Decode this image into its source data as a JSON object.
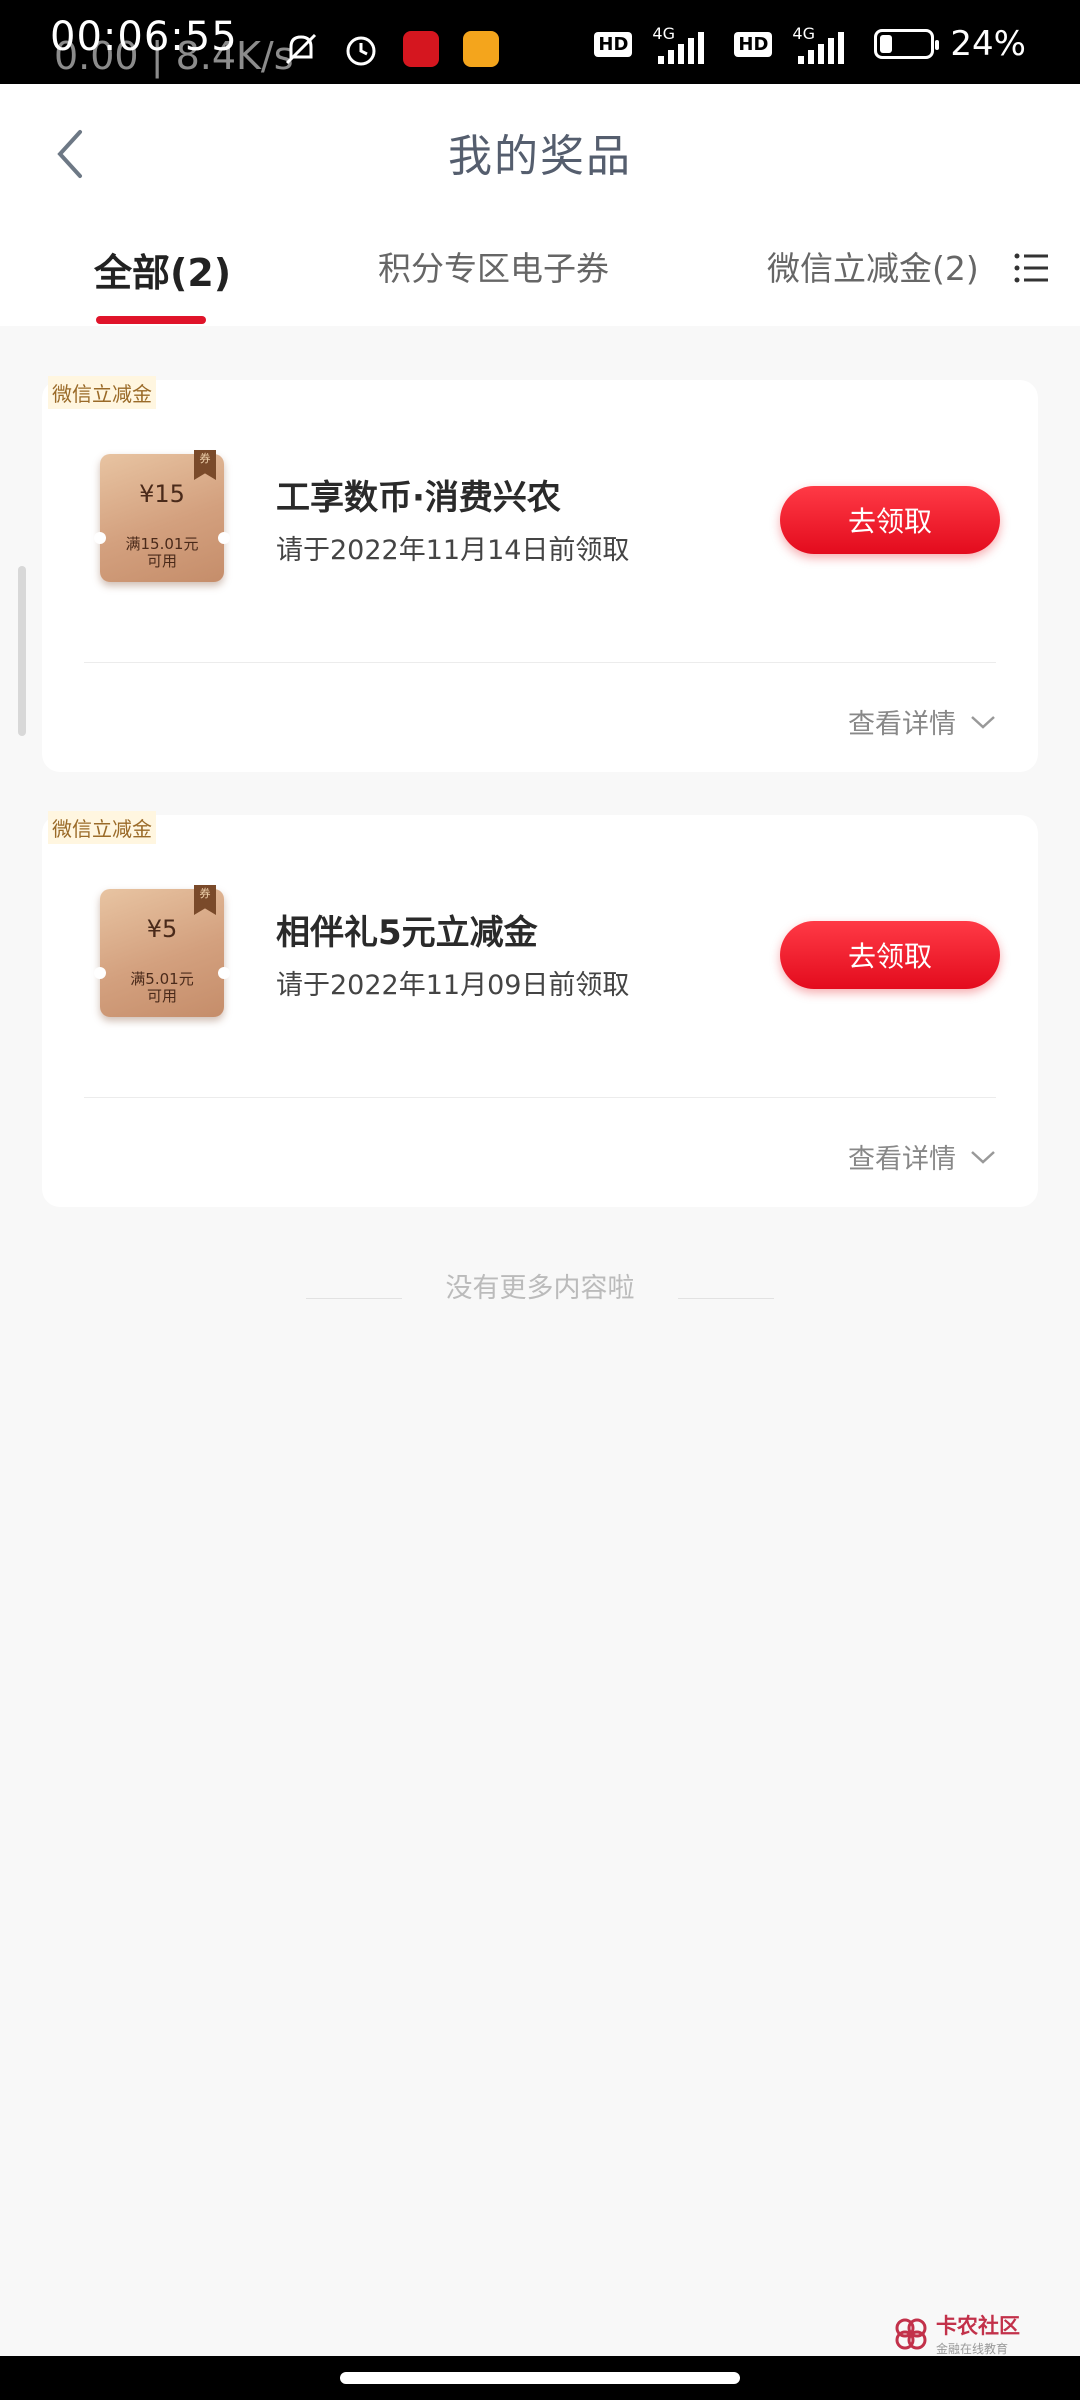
{
  "status_bar": {
    "time": "00:06:55",
    "net_speed": "0.00 | 8.4K/s",
    "hd1": "HD",
    "net1": "4G",
    "hd2": "HD",
    "net2": "4G",
    "battery_percent": "24%",
    "battery_level": 0.24
  },
  "header": {
    "title": "我的奖品"
  },
  "tabs": [
    {
      "label": "全部(2)",
      "active": true
    },
    {
      "label": "积分专区电子券",
      "active": false
    },
    {
      "label": "微信立减金(2)",
      "active": false
    }
  ],
  "prizes": [
    {
      "tag": "微信立减金",
      "coupon_amount": "¥15",
      "coupon_condition_line1": "满15.01元",
      "coupon_condition_line2": "可用",
      "ribbon": "券",
      "name": "工享数币·消费兴农",
      "deadline": "请于2022年11月14日前领取",
      "action": "去领取",
      "details": "查看详情"
    },
    {
      "tag": "微信立减金",
      "coupon_amount": "¥5",
      "coupon_condition_line1": "满5.01元",
      "coupon_condition_line2": "可用",
      "ribbon": "券",
      "name": "相伴礼5元立减金",
      "deadline": "请于2022年11月09日前领取",
      "action": "去领取",
      "details": "查看详情"
    }
  ],
  "footer": {
    "no_more": "没有更多内容啦"
  },
  "watermark": {
    "title": "卡农社区",
    "subtitle": "金融在线教育"
  },
  "colors": {
    "accent": "#e0142a",
    "title": "#555e6e",
    "background": "#f8f8f8"
  }
}
